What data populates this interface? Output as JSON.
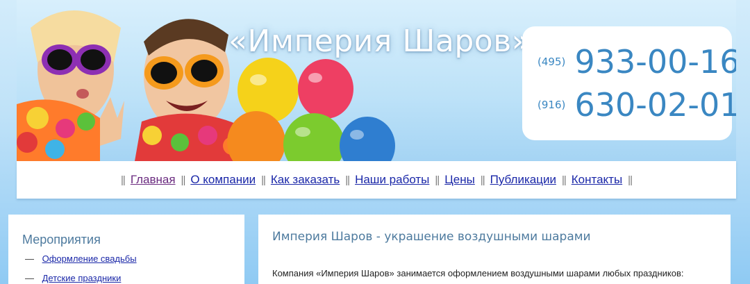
{
  "header": {
    "site_title": "«Империя Шаров»",
    "phones": [
      {
        "code": "(495)",
        "number": "933-00-16"
      },
      {
        "code": "(916)",
        "number": "630-02-01"
      }
    ]
  },
  "nav": {
    "separator": "||",
    "items": [
      {
        "label": "Главная",
        "visited": true
      },
      {
        "label": "О компании"
      },
      {
        "label": "Как заказать"
      },
      {
        "label": "Наши работы"
      },
      {
        "label": "Цены"
      },
      {
        "label": "Публикации"
      },
      {
        "label": "Контакты"
      }
    ]
  },
  "sidebar": {
    "title": "Мероприятия",
    "bullet": "—",
    "items": [
      {
        "label": "Оформление свадьбы"
      },
      {
        "label": "Детские праздники"
      }
    ]
  },
  "main": {
    "title": "Империя Шаров - украшение воздушными шарами",
    "intro": "Компания «Империя Шаров» занимается оформлением воздушными шарами любых праздников:"
  },
  "colors": {
    "accent_blue": "#3a87c2",
    "link": "#1a27a8",
    "link_visited": "#6a2a7f",
    "heading": "#4d7a9e"
  }
}
